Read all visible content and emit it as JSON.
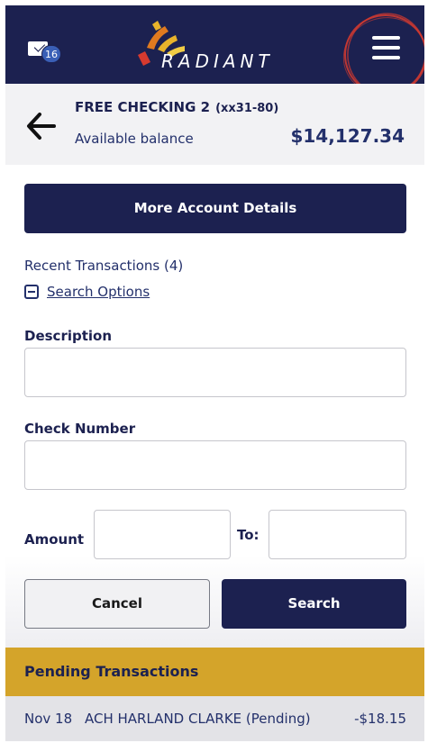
{
  "header": {
    "mail_badge": "16",
    "logo_text": "RADIANT",
    "icons": {
      "mail": "mail-icon",
      "menu": "hamburger-menu-icon",
      "back": "back-arrow-icon"
    },
    "colors": {
      "brand_navy": "#1c2150",
      "accent_gold": "#d4a42a",
      "accent_red": "#d63a2f"
    }
  },
  "account": {
    "name": "FREE CHECKING 2",
    "mask": "(xx31-80)",
    "balance_label": "Available balance",
    "balance": "$14,127.34"
  },
  "actions": {
    "more_details": "More Account Details"
  },
  "transactions": {
    "recent_label": "Recent Transactions (4)",
    "search_options_label": "Search Options"
  },
  "search_form": {
    "description_label": "Description",
    "description_value": "",
    "check_label": "Check Number",
    "check_value": "",
    "amount_label": "Amount",
    "amount_from_value": "",
    "to_label": "To:",
    "amount_to_value": "",
    "cancel_label": "Cancel",
    "search_label": "Search"
  },
  "pending": {
    "title": "Pending Transactions",
    "rows": [
      {
        "date": "Nov 18",
        "description": "ACH HARLAND CLARKE (Pending)",
        "amount": "-$18.15"
      }
    ]
  }
}
